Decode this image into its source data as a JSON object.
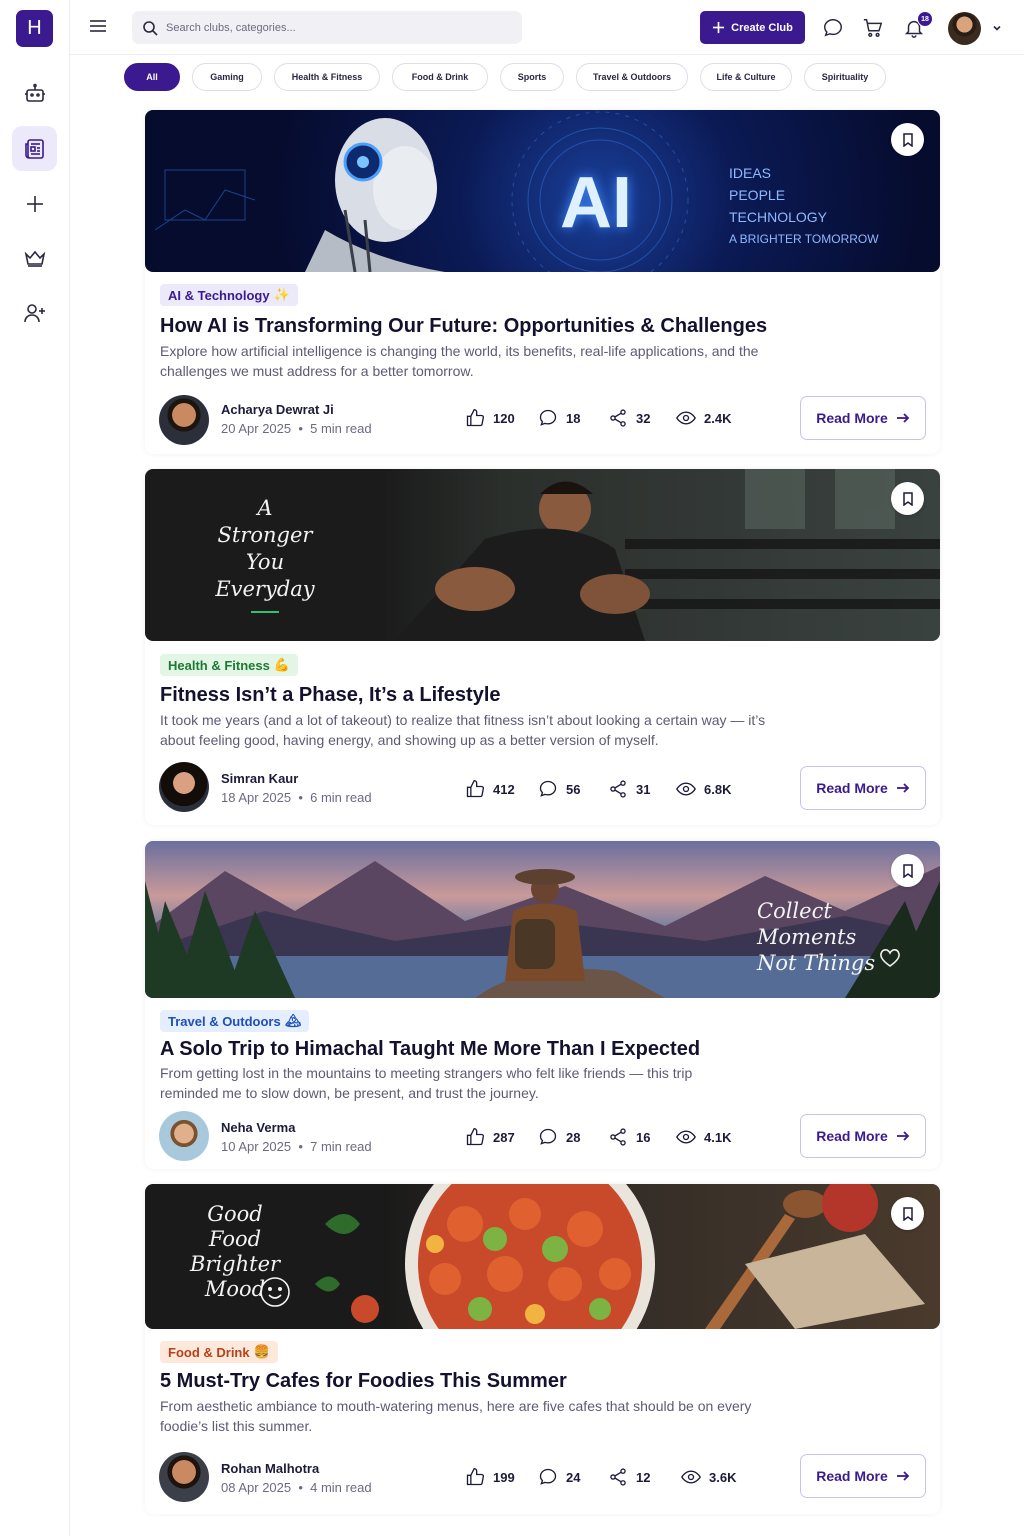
{
  "app": {
    "logo_letter": "H"
  },
  "header": {
    "search_placeholder": "Search clubs, categories...",
    "create_label": "Create Club",
    "notification_count": "18"
  },
  "filters": [
    "All",
    "Gaming",
    "Health & Fitness",
    "Food & Drink",
    "Sports",
    "Travel & Outdoors",
    "Life & Culture",
    "Spirituality"
  ],
  "active_filter": "All",
  "colors": {
    "brand": "#3b1a8f",
    "accent_light": "#ece9fb"
  },
  "posts": [
    {
      "banner_text": [
        "AI",
        "IDEAS",
        "PEOPLE",
        "TECHNOLOGY",
        "A BRIGHTER TOMORROW"
      ],
      "tag": "AI & Technology",
      "tag_emoji": "✨",
      "title": "How AI is Transforming Our Future: Opportunities & Challenges",
      "desc": "Explore how artificial intelligence is changing the world, its benefits, real-life applications, and the challenges we must address for a better tomorrow.",
      "author": "Acharya Dewrat Ji",
      "date": "20 Apr 2025",
      "read": "5 min read",
      "likes": "120",
      "comments": "18",
      "shares": "32",
      "views": "2.4K",
      "cta": "Read More"
    },
    {
      "banner_text": [
        "A",
        "Stronger",
        "You",
        "Everyday"
      ],
      "tag": "Health & Fitness",
      "tag_emoji": "💪",
      "title": "Fitness Isn’t a Phase, It’s a Lifestyle",
      "desc": "It took me years (and a lot of takeout) to realize that fitness isn’t about looking a certain way — it’s about feeling good, having energy, and showing up as a better version of myself.",
      "author": "Simran Kaur",
      "date": "18 Apr 2025",
      "read": "6 min read",
      "likes": "412",
      "comments": "56",
      "shares": "31",
      "views": "6.8K",
      "cta": "Read More"
    },
    {
      "banner_text": [
        "Collect",
        "Moments",
        "Not Things"
      ],
      "tag": "Travel & Outdoors",
      "tag_emoji": "🏔",
      "title": "A Solo Trip to Himachal Taught Me More Than I Expected",
      "desc": "From getting lost in the mountains to meeting strangers who felt like friends — this trip reminded me to slow down, be present, and trust the journey.",
      "author": "Neha Verma",
      "date": "10 Apr 2025",
      "read": "7 min read",
      "likes": "287",
      "comments": "28",
      "shares": "16",
      "views": "4.1K",
      "cta": "Read More"
    },
    {
      "banner_text": [
        "Good",
        "Food",
        "Brighter",
        "Mood"
      ],
      "tag": "Food & Drink",
      "tag_emoji": "🍔",
      "title": "5 Must-Try Cafes for Foodies This Summer",
      "desc": "From aesthetic ambiance to mouth-watering menus, here are five cafes that should be on every foodie’s list this summer.",
      "author": "Rohan Malhotra",
      "date": "08 Apr 2025",
      "read": "4 min read",
      "likes": "199",
      "comments": "24",
      "shares": "12",
      "views": "3.6K",
      "cta": "Read More"
    }
  ]
}
